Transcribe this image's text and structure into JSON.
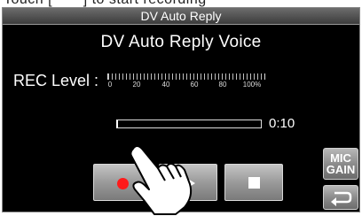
{
  "window": {
    "title": "DV Auto Reply"
  },
  "page": {
    "heading": "DV Auto Reply Voice"
  },
  "rec_level": {
    "label": "REC Level :",
    "scale_ticks": [
      "0",
      "20",
      "40",
      "60",
      "80",
      "100%"
    ]
  },
  "recording": {
    "time": "0:10",
    "progress_fraction": 0.0
  },
  "side_buttons": {
    "mic_gain_line1": "MIC",
    "mic_gain_line2": "GAIN",
    "return_icon": "return-arrow-icon"
  },
  "controls": {
    "record_icon": "record-icon",
    "play_icon": "play-icon",
    "stop_icon": "stop-icon"
  },
  "colors": {
    "background": "#000000",
    "titlebar": "#4a4a4a",
    "record": "#ff1a1a",
    "text": "#ffffff"
  }
}
